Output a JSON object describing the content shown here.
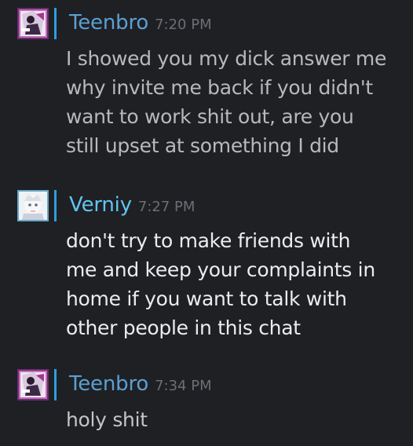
{
  "messages": [
    {
      "username": "Teenbro",
      "time": "7:20 PM",
      "lines": [
        "I showed you my dick answer me",
        "why invite me back if you didn't",
        "want to work shit out, are you",
        "still upset at something I did"
      ]
    },
    {
      "username": "Verniy",
      "time": "7:27 PM",
      "lines": [
        "don't try to make friends with",
        "me and keep your complaints in",
        "home if you want to talk with",
        "other people in this chat"
      ]
    },
    {
      "username": "Teenbro",
      "time": "7:34 PM",
      "lines": [
        "holy shit"
      ]
    }
  ],
  "colors": {
    "background": "#1e2024",
    "username_teenbro": "#5c9fd1",
    "username_verniy": "#62c3ef",
    "timestamp": "#6b6e73",
    "online_indicator": "#2f9ee0"
  }
}
